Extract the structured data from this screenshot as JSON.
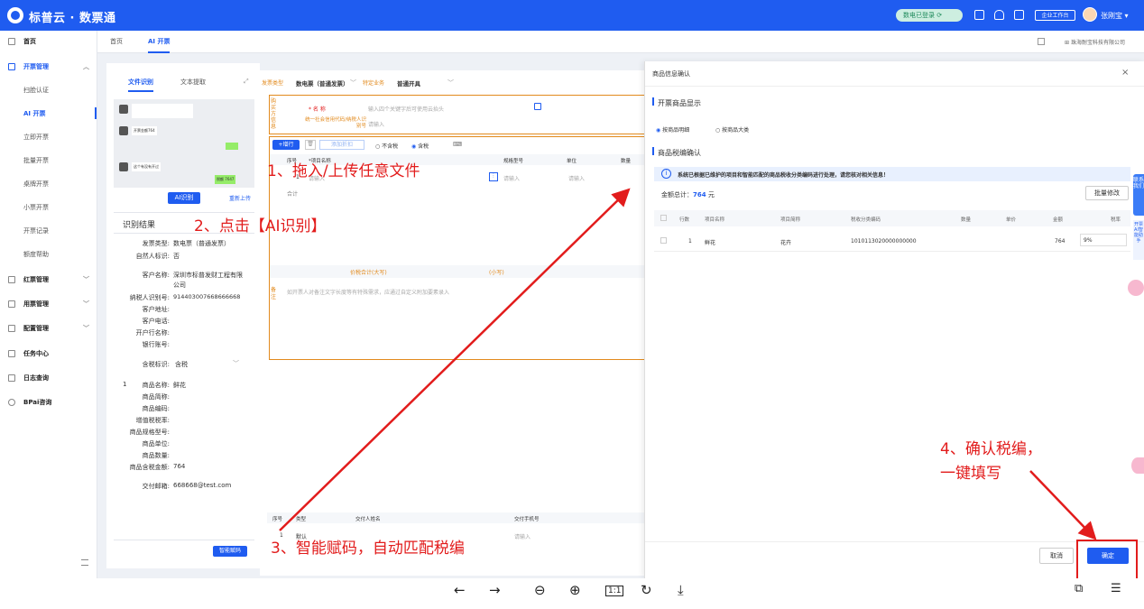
{
  "app": {
    "title": "标普云 · 数票通"
  },
  "topbar": {
    "status": "数电已登录",
    "workbench": "企业工作台",
    "user": "张刚宝"
  },
  "sidebar": {
    "items": [
      {
        "label": "首页"
      },
      {
        "label": "开票管理"
      },
      {
        "label": "扫脸认证"
      },
      {
        "label": "AI 开票"
      },
      {
        "label": "立即开票"
      },
      {
        "label": "批量开票"
      },
      {
        "label": "桌牌开票"
      },
      {
        "label": "小票开票"
      },
      {
        "label": "开票记录"
      },
      {
        "label": "额度帮助"
      },
      {
        "label": "红票管理"
      },
      {
        "label": "用票管理"
      },
      {
        "label": "配置管理"
      },
      {
        "label": "任务中心"
      },
      {
        "label": "日志查询"
      },
      {
        "label": "BPai咨询"
      }
    ]
  },
  "tabs": [
    {
      "label": "首页"
    },
    {
      "label": "AI 开票"
    }
  ],
  "company": "珠海耐宝科技有限公司",
  "left": {
    "tab_file": "文件识别",
    "tab_text": "文本提取",
    "chat_texts": [
      "开票金额764",
      "这个有没有开过",
      "税额 7647"
    ],
    "ai_button": "AI识别",
    "reupload": "重新上传",
    "result_title": "识别结果",
    "fields": [
      {
        "k": "发票类型:",
        "v": "数电票（普通发票）"
      },
      {
        "k": "自然人标识:",
        "v": "否"
      },
      {
        "k": "客户名称:",
        "v": "深圳市标普发财工程有限公司"
      },
      {
        "k": "纳税人识别号:",
        "v": "914403007668666668"
      },
      {
        "k": "客户地址:",
        "v": ""
      },
      {
        "k": "客户电话:",
        "v": ""
      },
      {
        "k": "开户行名称:",
        "v": ""
      },
      {
        "k": "银行账号:",
        "v": ""
      },
      {
        "k": "含税标识:",
        "v": "含税"
      }
    ],
    "item_index": "1",
    "item_fields": [
      {
        "k": "商品名称:",
        "v": "鲜花"
      },
      {
        "k": "商品简称:",
        "v": ""
      },
      {
        "k": "商品编码:",
        "v": ""
      },
      {
        "k": "增值税税率:",
        "v": ""
      },
      {
        "k": "商品规格型号:",
        "v": ""
      },
      {
        "k": "商品单位:",
        "v": ""
      },
      {
        "k": "商品数量:",
        "v": ""
      },
      {
        "k": "商品含税金额:",
        "v": "764"
      }
    ],
    "delivery_email_label": "交付邮箱:",
    "delivery_email": "668668@test.com",
    "smart_button": "智能赋码"
  },
  "form": {
    "invoice_type_label": "发票类型",
    "invoice_type": "数电票（普通发票）",
    "special_label": "特定业务",
    "special_value": "普通开具",
    "buyer_side": "购买方信息",
    "name_label": "* 名 称",
    "name_placeholder": "输入四个关键字后可使用云抬头",
    "tax_label": "统一社会信用代码/纳税人识别号",
    "tax_placeholder": "请输入",
    "add_row": "+增行",
    "add_discount": "添加折扣",
    "no_tax": "不含税",
    "with_tax": "含税",
    "col_index": "序号",
    "col_name": "*项目名称",
    "col_spec": "规格型号",
    "col_unit": "单位",
    "col_qty": "数量",
    "row_placeholder": "请输入",
    "total": "合计",
    "tax_total": "价税合计(大写)",
    "tax_total_small": "(小写)",
    "note_side": "备注",
    "note_placeholder": "如开票人对备注文字长度等有特殊需求，应通过自定义附加要素录入",
    "bottom_col_index": "序号",
    "bottom_col_type": "类型",
    "bottom_col_person": "交付人姓名",
    "bottom_col_phone": "交付手机号",
    "bottom_row_index": "1",
    "bottom_row_type": "默认",
    "bottom_placeholder": "请输入"
  },
  "dialog": {
    "title": "商品信息确认",
    "section1": "开票商品显示",
    "radio1": "按商品明细",
    "radio2": "按商品大类",
    "section2": "商品税编确认",
    "notice": "系统已根据已维护的项目和智能匹配的商品税收分类编码进行处理，请您核对相关信息！",
    "total_label": "金额总计：",
    "total_value": "764",
    "total_unit": "元",
    "batch_edit": "批量修改",
    "columns": [
      "行数",
      "项目名称",
      "项目简称",
      "税收分类编码",
      "数量",
      "单价",
      "金额",
      "税率"
    ],
    "rows": [
      {
        "line": "1",
        "name": "鲜花",
        "short": "花卉",
        "code": "1010113020000000000",
        "qty": "",
        "price": "",
        "amount": "764",
        "rate": "9%"
      }
    ],
    "cancel": "取消",
    "confirm": "确定"
  },
  "side_float": {
    "contact": "联系我们",
    "smart": "开票AI智能助手"
  },
  "annotations": {
    "a1": "1、拖入/上传任意文件",
    "a2": "2、点击【AI识别】",
    "a3": "3、智能赋码，自动匹配税编",
    "a4_line1": "4、确认税编，",
    "a4_line2": "一键填写"
  },
  "colors": {
    "primary": "#1f5cf0",
    "annotation": "#e21c1c"
  }
}
